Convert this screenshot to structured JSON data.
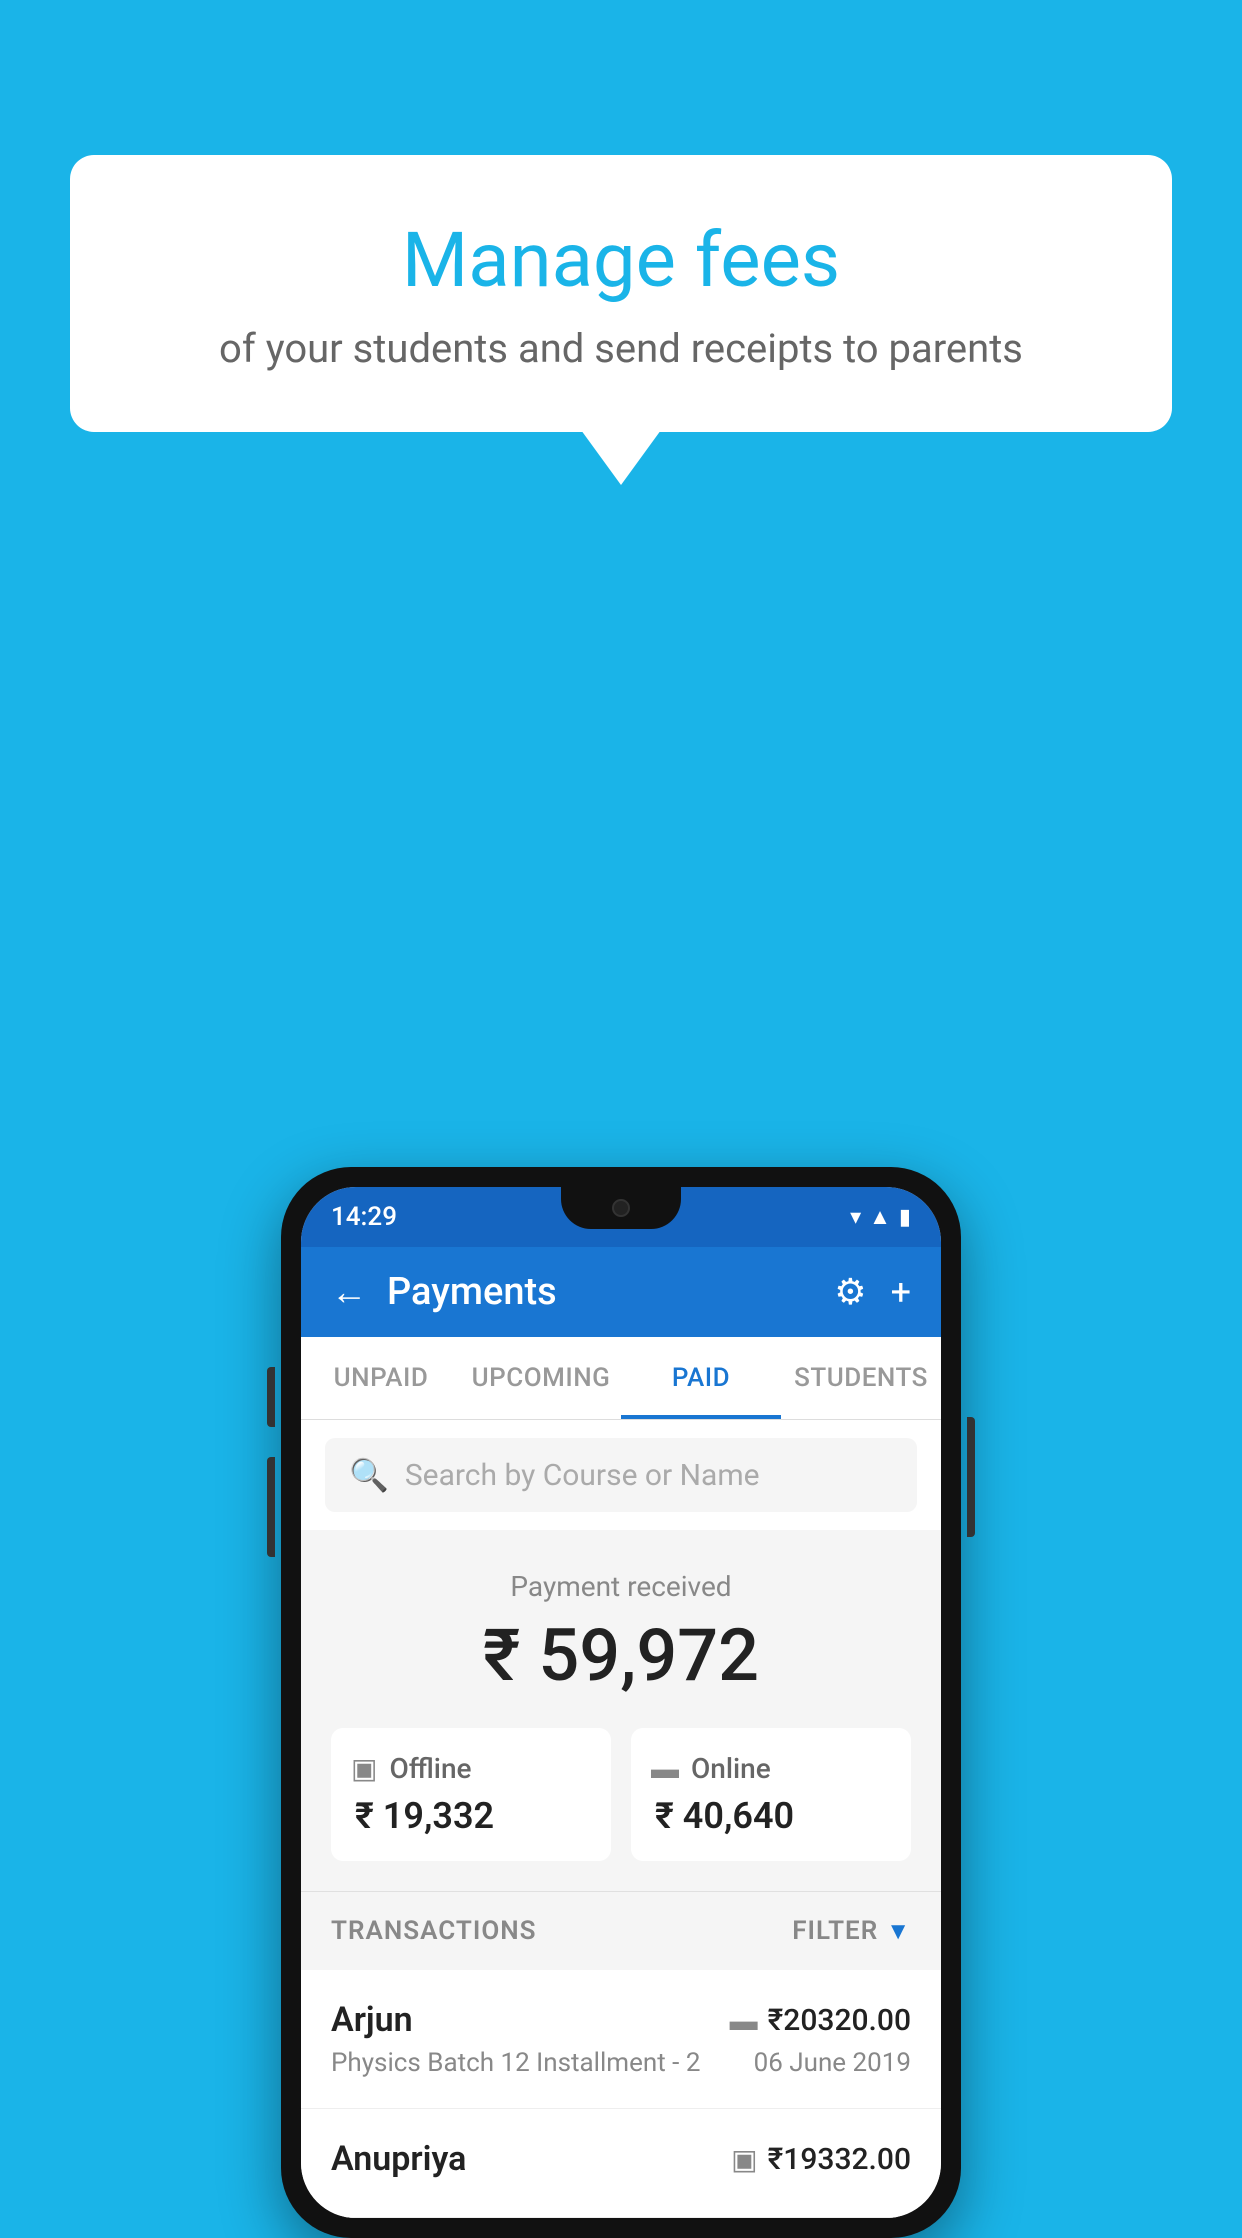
{
  "background_color": "#1ab4e8",
  "speech_bubble": {
    "title": "Manage fees",
    "subtitle": "of your students and send receipts to parents"
  },
  "phone": {
    "status_bar": {
      "time": "14:29",
      "signal_icon": "▼◀▮"
    },
    "app_bar": {
      "back_label": "←",
      "title": "Payments",
      "gear_icon": "⚙",
      "plus_icon": "+"
    },
    "tabs": [
      {
        "label": "UNPAID",
        "active": false
      },
      {
        "label": "UPCOMING",
        "active": false
      },
      {
        "label": "PAID",
        "active": true
      },
      {
        "label": "STUDENTS",
        "active": false
      }
    ],
    "search": {
      "placeholder": "Search by Course or Name"
    },
    "payment_summary": {
      "label": "Payment received",
      "total": "₹ 59,972",
      "offline": {
        "label": "Offline",
        "amount": "₹ 19,332"
      },
      "online": {
        "label": "Online",
        "amount": "₹ 40,640"
      }
    },
    "transactions": {
      "label": "TRANSACTIONS",
      "filter_label": "FILTER",
      "items": [
        {
          "name": "Arjun",
          "detail": "Physics Batch 12 Installment - 2",
          "amount": "₹20320.00",
          "date": "06 June 2019",
          "icon": "card"
        },
        {
          "name": "Anupriya",
          "detail": "",
          "amount": "₹19332.00",
          "date": "",
          "icon": "cash"
        }
      ]
    }
  }
}
